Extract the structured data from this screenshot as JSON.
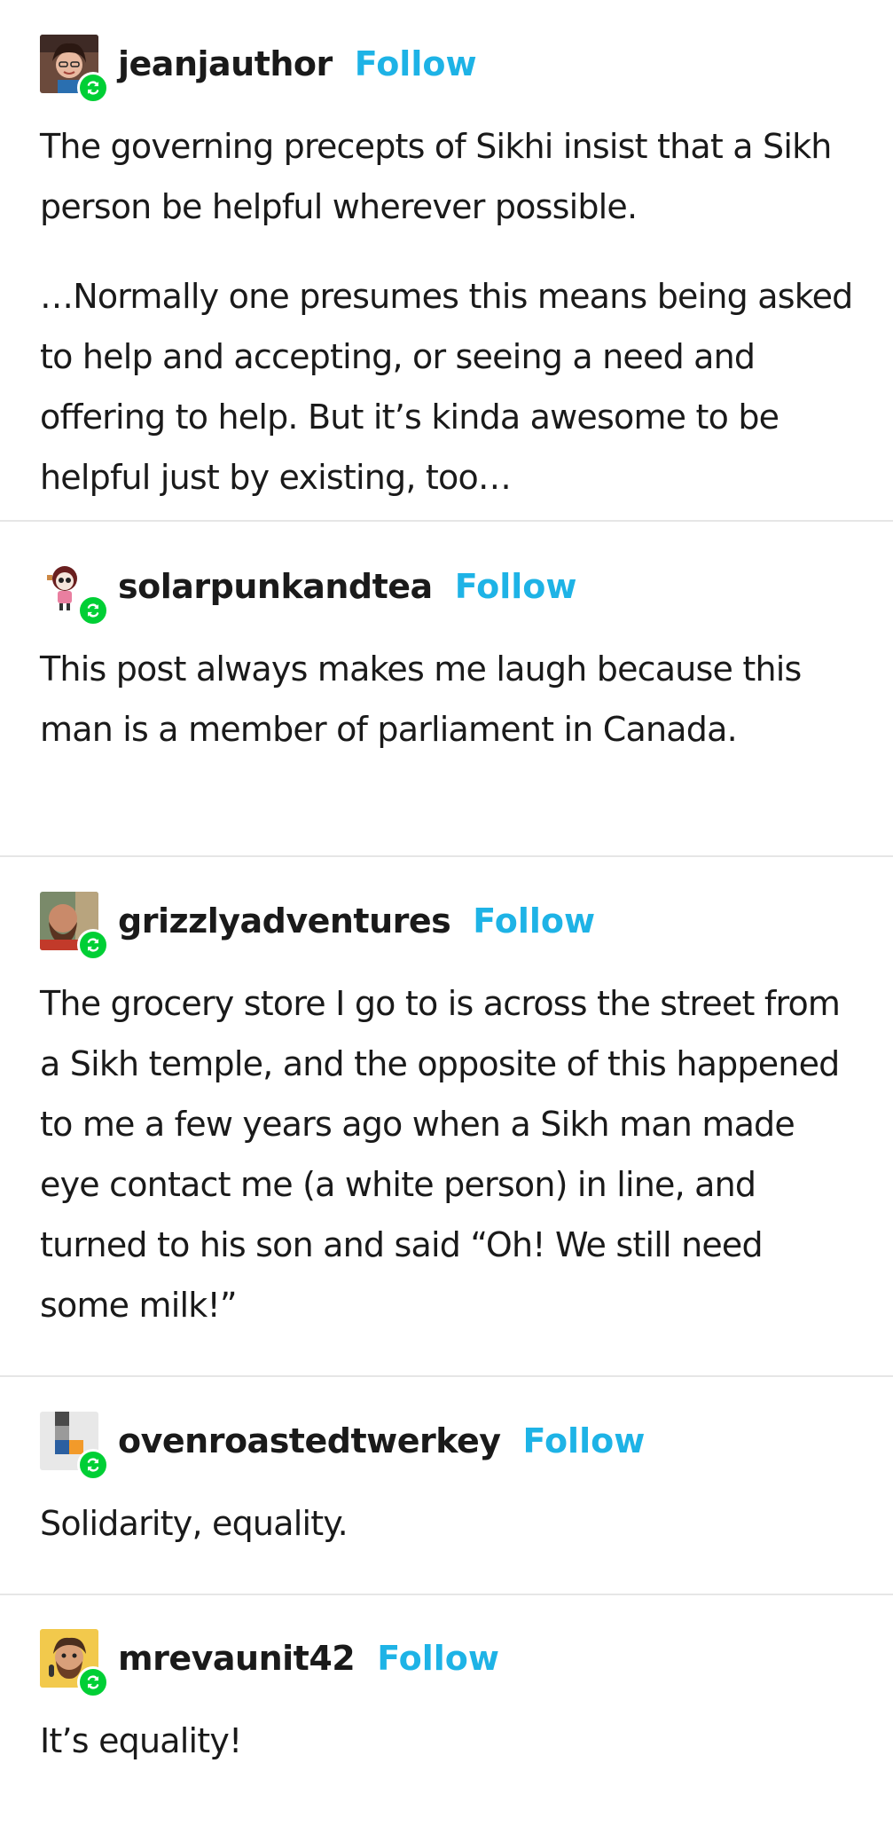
{
  "thread": {
    "follow_label": "Follow",
    "posts": [
      {
        "username": "jeanjauthor",
        "paragraphs": [
          "The governing precepts of Sikhi insist that a Sikh person be helpful wherever possible.",
          "…Normally one presumes this means being asked to help and accepting, or seeing a need and offering to help.  But it’s kinda awesome to be helpful just by existing, too…"
        ]
      },
      {
        "username": "solarpunkandtea",
        "paragraphs": [
          "This post always makes me laugh because this man is a member of parliament in Canada."
        ]
      },
      {
        "username": "grizzlyadventures",
        "paragraphs": [
          "The grocery store I go to is across the street from a Sikh temple, and the opposite of this happened to me a few years ago when a Sikh man made eye contact me (a white person) in line, and turned to his son and said “Oh! We still need some milk!”"
        ]
      },
      {
        "username": "ovenroastedtwerkey",
        "paragraphs": [
          "Solidarity, equality."
        ]
      },
      {
        "username": "mrevaunit42",
        "paragraphs": [
          "It’s equality!"
        ]
      }
    ]
  },
  "colors": {
    "follow": "#1eb3e6",
    "reblog_badge": "#00cf35",
    "text": "#1a1a1a",
    "divider": "#e6e6e6"
  },
  "icons": {
    "reblog_badge": "reblog-icon"
  }
}
